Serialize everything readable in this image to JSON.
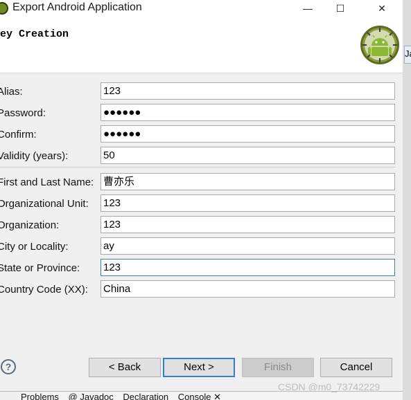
{
  "window": {
    "title": "Export Android Application",
    "minimize_glyph": "—",
    "maximize_glyph": "☐",
    "close_glyph": "✕"
  },
  "header": {
    "title": "ey Creation"
  },
  "right_tab": {
    "label": "Ja"
  },
  "form": {
    "alias": {
      "label": "Alias:",
      "value": "123"
    },
    "password": {
      "label": "Password:",
      "value": "●●●●●●"
    },
    "confirm": {
      "label": "Confirm:",
      "value": "●●●●●●"
    },
    "validity": {
      "label": "Validity (years):",
      "value": "50"
    },
    "name": {
      "label": "First and Last Name:",
      "value": "曹亦乐"
    },
    "org_unit": {
      "label": "Organizational Unit:",
      "value": "123"
    },
    "organization": {
      "label": "Organization:",
      "value": "123"
    },
    "city": {
      "label": "City or Locality:",
      "value": "ay"
    },
    "state": {
      "label": "State or Province:",
      "value": "123"
    },
    "country": {
      "label": "Country Code (XX):",
      "value": "China"
    }
  },
  "buttons": {
    "help_glyph": "?",
    "back": "< Back",
    "next": "Next >",
    "finish": "Finish",
    "cancel": "Cancel"
  },
  "taskbar": {
    "items": [
      "Problems",
      "@ Javadoc",
      "Declaration",
      "Console ✕"
    ]
  },
  "watermark": "CSDN @m0_73742229",
  "colors": {
    "accent": "#2f7ed8",
    "android_green": "#8ab833"
  }
}
